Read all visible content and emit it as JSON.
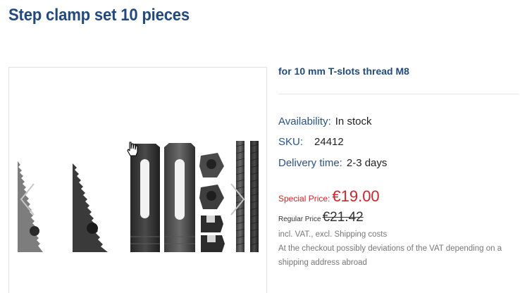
{
  "product": {
    "title": "Step clamp set 10 pieces",
    "subtitle": "for 10 mm T-slots thread M8",
    "availability_label": "Availability:",
    "availability_value": "In stock",
    "sku_label": "SKU:",
    "sku_value": "24412",
    "delivery_label": "Delivery time:",
    "delivery_value": "2-3 days",
    "special_price_label": "Special Price:",
    "special_price_value": "€19.00",
    "regular_price_label": "Regular Price",
    "regular_price_value": "€21.42",
    "vat_note": "incl. VAT., excl. Shipping costs",
    "checkout_note_line1": "At the checkout possibly deviations of the VAT depending on a",
    "checkout_note_line2": "shipping address abroad"
  },
  "gallery": {
    "prev_icon": "chevron-left-icon",
    "next_icon": "chevron-right-icon",
    "cursor_icon": "hand-pointer-icon"
  },
  "colors": {
    "title": "#234a7c",
    "label": "#2a5389",
    "special_price": "#d2232a",
    "note": "#777777"
  }
}
